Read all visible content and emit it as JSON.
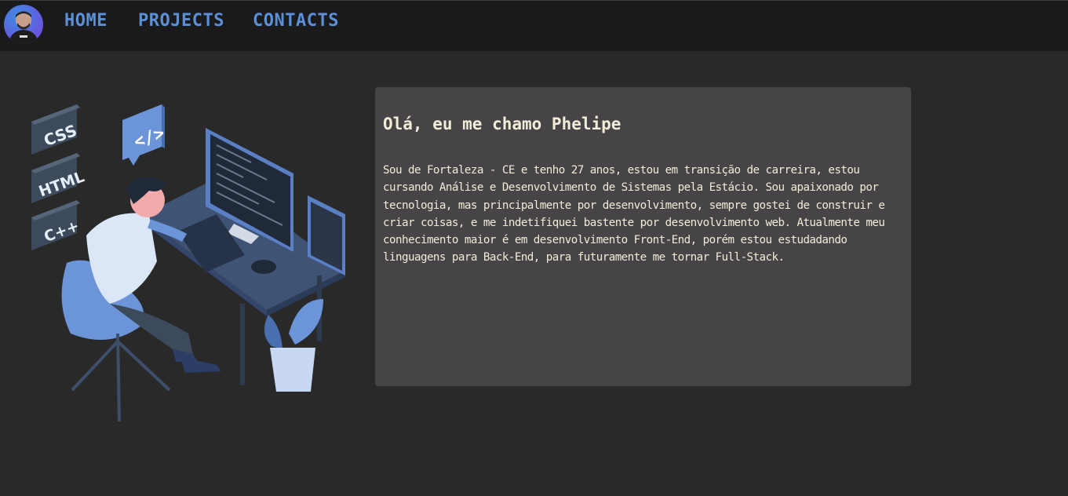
{
  "navbar": {
    "avatar_icon": "profile-photo",
    "links": [
      {
        "label": "HOME"
      },
      {
        "label": "PROJECTS"
      },
      {
        "label": "CONTACTS"
      }
    ]
  },
  "illustration": {
    "icon": "developer-at-desk-illustration",
    "tags": [
      "CSS",
      "HTML",
      "C++"
    ],
    "code_badge": "</>"
  },
  "about": {
    "title": "Olá, eu me chamo Phelipe",
    "text": "Sou de Fortaleza - CE e tenho 27 anos, estou em transição de carreira, estou cursando Análise e Desenvolvimento de Sistemas pela Estácio. Sou apaixonado por tecnologia, mas principalmente por desenvolvimento, sempre gostei de construir e criar coisas, e me indetifiquei bastente por desenvolvimento web. Atualmente meu conhecimento maior é em desenvolvimento Front-End, porém estou estudadando linguagens para Back-End, para futuramente me tornar Full-Stack."
  },
  "colors": {
    "background": "#292929",
    "navbar": "#1b1a1b",
    "nav_link": "#5b8fd8",
    "card": "#464446",
    "card_text": "#f3ecd9",
    "illustration_blue": "#6b95d8"
  }
}
